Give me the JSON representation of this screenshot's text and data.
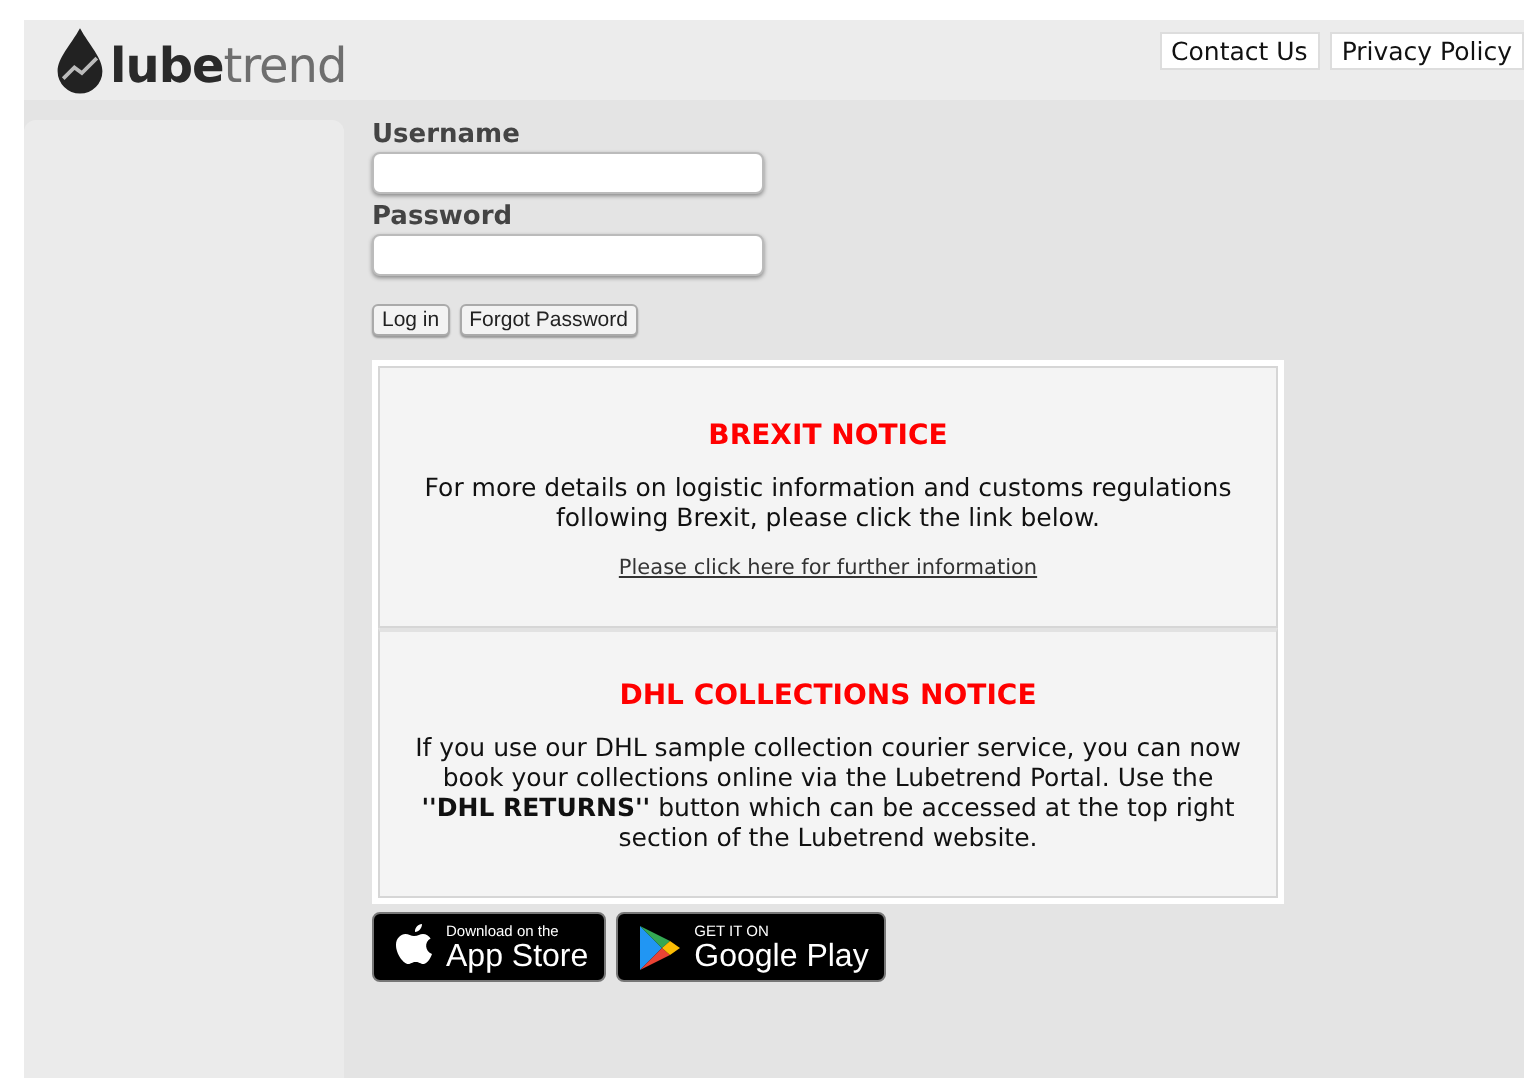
{
  "logo": {
    "text": "**lube**trend"
  },
  "header_links": [
    "Contact Us",
    "Privacy Policy"
  ],
  "login": {
    "username_label": "Username",
    "password_label": "Password",
    "buttons": [
      "Log in",
      "Forgot Password"
    ]
  },
  "notices": [
    {
      "title": "BREXIT NOTICE",
      "body": "For more details on logistic information and customs regulations following Brexit, please click the link below.",
      "link": "Please click here for further information"
    },
    {
      "title": "DHL COLLECTIONS NOTICE",
      "body": "If you use our DHL sample collection courier service, you can now book your collections online via the Lubetrend Portal. Use the **''DHL RETURNS''** button which can be accessed at the top right section of the Lubetrend website."
    }
  ],
  "store_badges": [
    {
      "kind": "apple",
      "small": "Download on the",
      "big": "App Store"
    },
    {
      "kind": "google",
      "small": "GET IT ON",
      "big": "Google Play"
    }
  ]
}
